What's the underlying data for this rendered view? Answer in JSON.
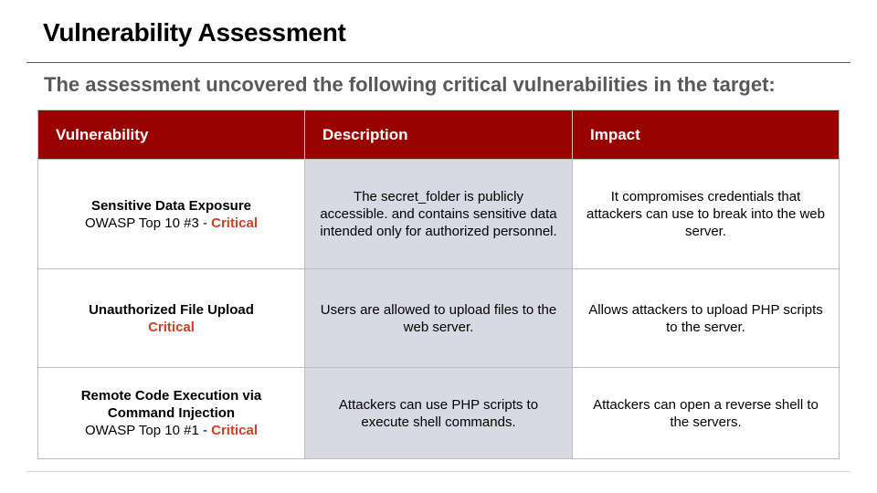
{
  "slide": {
    "title": "Vulnerability Assessment",
    "subtitle": "The assessment uncovered the following critical vulnerabilities in the target:"
  },
  "table": {
    "headers": [
      "Vulnerability",
      "Description",
      "Impact"
    ],
    "rows": [
      {
        "name": "Sensitive Data Exposure",
        "category": "OWASP Top 10 #3 - ",
        "severity": "Critical",
        "description": "The secret_folder is publicly accessible. and contains sensitive data intended only for authorized personnel.",
        "impact": "It compromises credentials that attackers can use to break into the web server."
      },
      {
        "name": "Unauthorized File Upload",
        "category": "",
        "severity": "Critical",
        "description": "Users are allowed to upload files to the web server.",
        "impact": "Allows attackers to upload PHP scripts to the server."
      },
      {
        "name": "Remote Code Execution via Command Injection",
        "category": "OWASP Top 10 #1 - ",
        "severity": "Critical",
        "description": "Attackers can use PHP scripts to execute shell commands.",
        "impact": "Attackers can open a reverse shell to the servers."
      }
    ]
  },
  "colors": {
    "header_bg": "#990000",
    "critical": "#cc4125",
    "description_bg": "#d9d9e3",
    "subtitle": "#595959"
  }
}
